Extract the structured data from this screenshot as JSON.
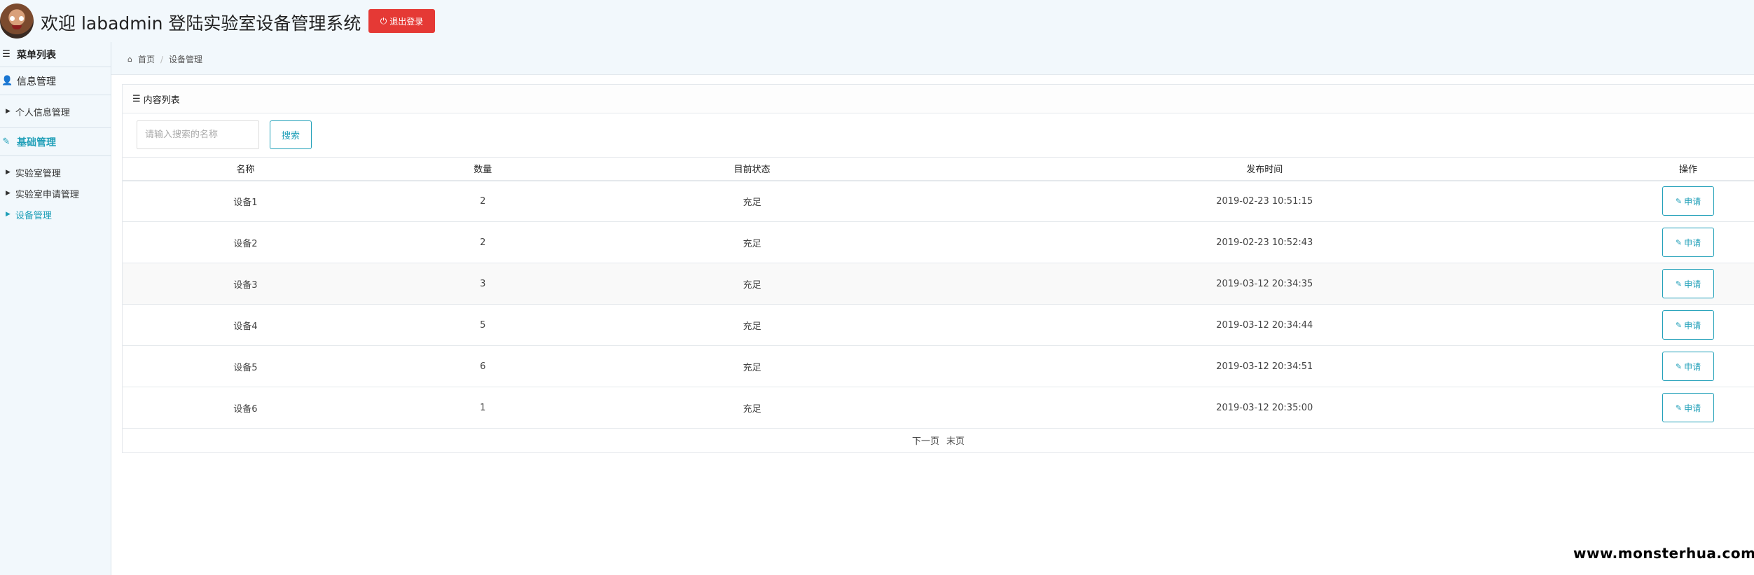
{
  "header": {
    "welcome": "欢迎 labadmin 登陆实验室设备管理系统",
    "logout_label": "退出登录",
    "logout_icon": "power-icon"
  },
  "sidebar": {
    "title": "菜单列表",
    "groups": [
      {
        "label": "信息管理",
        "icon": "user-icon",
        "items": [
          {
            "label": "个人信息管理"
          }
        ]
      },
      {
        "label": "基础管理",
        "icon": "edit-icon",
        "items": [
          {
            "label": "实验室管理"
          },
          {
            "label": "实验室申请管理"
          },
          {
            "label": "设备管理"
          }
        ]
      }
    ]
  },
  "breadcrumb": {
    "home": "首页",
    "current": "设备管理"
  },
  "panel": {
    "title": "内容列表",
    "search_placeholder": "请输入搜索的名称",
    "search_label": "搜索"
  },
  "table": {
    "headers": [
      "名称",
      "数量",
      "目前状态",
      "发布时间",
      "操作"
    ],
    "rows": [
      {
        "name": "设备1",
        "qty": "2",
        "status": "充足",
        "time": "2019-02-23 10:51:15",
        "action": "申请"
      },
      {
        "name": "设备2",
        "qty": "2",
        "status": "充足",
        "time": "2019-02-23 10:52:43",
        "action": "申请"
      },
      {
        "name": "设备3",
        "qty": "3",
        "status": "充足",
        "time": "2019-03-12 20:34:35",
        "action": "申请"
      },
      {
        "name": "设备4",
        "qty": "5",
        "status": "充足",
        "time": "2019-03-12 20:34:44",
        "action": "申请"
      },
      {
        "name": "设备5",
        "qty": "6",
        "status": "充足",
        "time": "2019-03-12 20:34:51",
        "action": "申请"
      },
      {
        "name": "设备6",
        "qty": "1",
        "status": "充足",
        "time": "2019-03-12 20:35:00",
        "action": "申请"
      }
    ]
  },
  "pager": {
    "next": "下一页",
    "last": "末页"
  },
  "watermark": "www.monsterhua.com",
  "colors": {
    "accent": "#1f9fb8",
    "danger": "#e53935",
    "background": "#f2f8fc"
  }
}
